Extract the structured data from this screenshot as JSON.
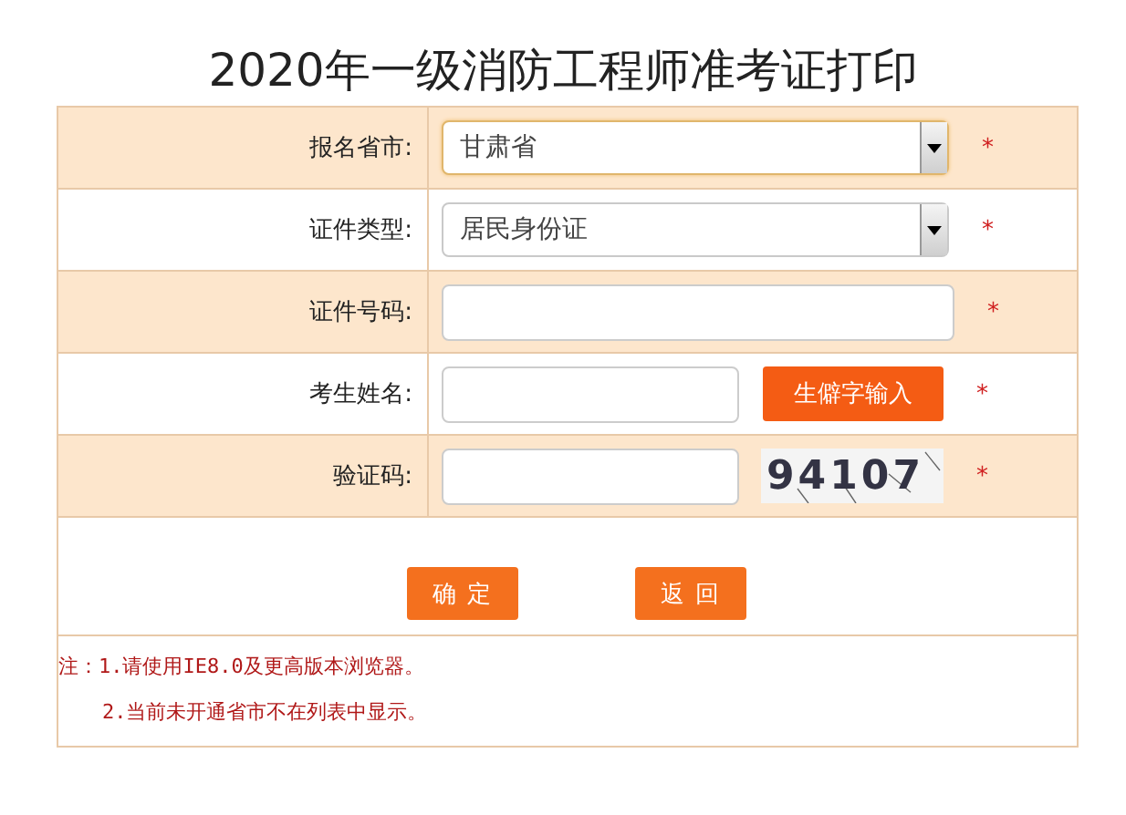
{
  "title": "2020年一级消防工程师准考证打印",
  "rows": [
    {
      "label": "报名省市:",
      "kind": "select",
      "value": "甘肃省",
      "focused": true,
      "required_mark": "*"
    },
    {
      "label": "证件类型:",
      "kind": "select",
      "value": "居民身份证",
      "focused": false,
      "required_mark": "*"
    },
    {
      "label": "证件号码:",
      "kind": "input",
      "required_mark": "*"
    },
    {
      "label": "考生姓名:",
      "kind": "input_button",
      "button": "生僻字输入",
      "required_mark": "*"
    },
    {
      "label": "验证码:",
      "kind": "captcha",
      "captcha": "94107",
      "required_mark": "*"
    }
  ],
  "buttons": [
    "确 定",
    "返 回"
  ],
  "notes_label": "注：",
  "notes": [
    "1.请使用IE8.0及更高版本浏览器。",
    "2.当前未开通省市不在列表中显示。"
  ]
}
